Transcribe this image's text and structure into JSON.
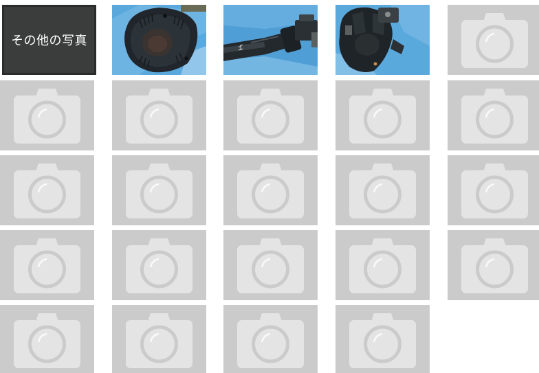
{
  "gallery": {
    "other_photos_label": "その他の写真",
    "photos": [
      {
        "name": "photo-1",
        "kind": "flange-end",
        "icon": "photo"
      },
      {
        "name": "photo-2",
        "kind": "shaft-joint",
        "icon": "photo"
      },
      {
        "name": "photo-3",
        "kind": "universal-joint",
        "icon": "photo"
      }
    ],
    "placeholder_count": 20,
    "placeholder_icon": "camera-icon",
    "colors": {
      "label_bg": "#3b3d3d",
      "placeholder_bg": "#cbcbcb",
      "camera_fill": "#e4e4e4",
      "tarp_blue": "#5aa9dd",
      "part_dark": "#1d2226"
    }
  }
}
